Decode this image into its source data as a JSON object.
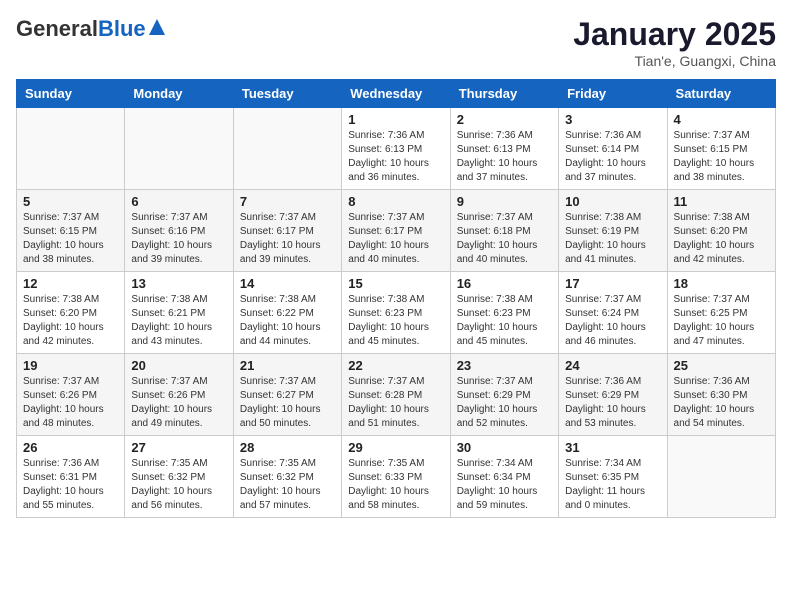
{
  "header": {
    "logo_general": "General",
    "logo_blue": "Blue",
    "month_title": "January 2025",
    "subtitle": "Tian'e, Guangxi, China"
  },
  "weekdays": [
    "Sunday",
    "Monday",
    "Tuesday",
    "Wednesday",
    "Thursday",
    "Friday",
    "Saturday"
  ],
  "weeks": [
    [
      {
        "day": "",
        "info": ""
      },
      {
        "day": "",
        "info": ""
      },
      {
        "day": "",
        "info": ""
      },
      {
        "day": "1",
        "info": "Sunrise: 7:36 AM\nSunset: 6:13 PM\nDaylight: 10 hours and 36 minutes."
      },
      {
        "day": "2",
        "info": "Sunrise: 7:36 AM\nSunset: 6:13 PM\nDaylight: 10 hours and 37 minutes."
      },
      {
        "day": "3",
        "info": "Sunrise: 7:36 AM\nSunset: 6:14 PM\nDaylight: 10 hours and 37 minutes."
      },
      {
        "day": "4",
        "info": "Sunrise: 7:37 AM\nSunset: 6:15 PM\nDaylight: 10 hours and 38 minutes."
      }
    ],
    [
      {
        "day": "5",
        "info": "Sunrise: 7:37 AM\nSunset: 6:15 PM\nDaylight: 10 hours and 38 minutes."
      },
      {
        "day": "6",
        "info": "Sunrise: 7:37 AM\nSunset: 6:16 PM\nDaylight: 10 hours and 39 minutes."
      },
      {
        "day": "7",
        "info": "Sunrise: 7:37 AM\nSunset: 6:17 PM\nDaylight: 10 hours and 39 minutes."
      },
      {
        "day": "8",
        "info": "Sunrise: 7:37 AM\nSunset: 6:17 PM\nDaylight: 10 hours and 40 minutes."
      },
      {
        "day": "9",
        "info": "Sunrise: 7:37 AM\nSunset: 6:18 PM\nDaylight: 10 hours and 40 minutes."
      },
      {
        "day": "10",
        "info": "Sunrise: 7:38 AM\nSunset: 6:19 PM\nDaylight: 10 hours and 41 minutes."
      },
      {
        "day": "11",
        "info": "Sunrise: 7:38 AM\nSunset: 6:20 PM\nDaylight: 10 hours and 42 minutes."
      }
    ],
    [
      {
        "day": "12",
        "info": "Sunrise: 7:38 AM\nSunset: 6:20 PM\nDaylight: 10 hours and 42 minutes."
      },
      {
        "day": "13",
        "info": "Sunrise: 7:38 AM\nSunset: 6:21 PM\nDaylight: 10 hours and 43 minutes."
      },
      {
        "day": "14",
        "info": "Sunrise: 7:38 AM\nSunset: 6:22 PM\nDaylight: 10 hours and 44 minutes."
      },
      {
        "day": "15",
        "info": "Sunrise: 7:38 AM\nSunset: 6:23 PM\nDaylight: 10 hours and 45 minutes."
      },
      {
        "day": "16",
        "info": "Sunrise: 7:38 AM\nSunset: 6:23 PM\nDaylight: 10 hours and 45 minutes."
      },
      {
        "day": "17",
        "info": "Sunrise: 7:37 AM\nSunset: 6:24 PM\nDaylight: 10 hours and 46 minutes."
      },
      {
        "day": "18",
        "info": "Sunrise: 7:37 AM\nSunset: 6:25 PM\nDaylight: 10 hours and 47 minutes."
      }
    ],
    [
      {
        "day": "19",
        "info": "Sunrise: 7:37 AM\nSunset: 6:26 PM\nDaylight: 10 hours and 48 minutes."
      },
      {
        "day": "20",
        "info": "Sunrise: 7:37 AM\nSunset: 6:26 PM\nDaylight: 10 hours and 49 minutes."
      },
      {
        "day": "21",
        "info": "Sunrise: 7:37 AM\nSunset: 6:27 PM\nDaylight: 10 hours and 50 minutes."
      },
      {
        "day": "22",
        "info": "Sunrise: 7:37 AM\nSunset: 6:28 PM\nDaylight: 10 hours and 51 minutes."
      },
      {
        "day": "23",
        "info": "Sunrise: 7:37 AM\nSunset: 6:29 PM\nDaylight: 10 hours and 52 minutes."
      },
      {
        "day": "24",
        "info": "Sunrise: 7:36 AM\nSunset: 6:29 PM\nDaylight: 10 hours and 53 minutes."
      },
      {
        "day": "25",
        "info": "Sunrise: 7:36 AM\nSunset: 6:30 PM\nDaylight: 10 hours and 54 minutes."
      }
    ],
    [
      {
        "day": "26",
        "info": "Sunrise: 7:36 AM\nSunset: 6:31 PM\nDaylight: 10 hours and 55 minutes."
      },
      {
        "day": "27",
        "info": "Sunrise: 7:35 AM\nSunset: 6:32 PM\nDaylight: 10 hours and 56 minutes."
      },
      {
        "day": "28",
        "info": "Sunrise: 7:35 AM\nSunset: 6:32 PM\nDaylight: 10 hours and 57 minutes."
      },
      {
        "day": "29",
        "info": "Sunrise: 7:35 AM\nSunset: 6:33 PM\nDaylight: 10 hours and 58 minutes."
      },
      {
        "day": "30",
        "info": "Sunrise: 7:34 AM\nSunset: 6:34 PM\nDaylight: 10 hours and 59 minutes."
      },
      {
        "day": "31",
        "info": "Sunrise: 7:34 AM\nSunset: 6:35 PM\nDaylight: 11 hours and 0 minutes."
      },
      {
        "day": "",
        "info": ""
      }
    ]
  ]
}
